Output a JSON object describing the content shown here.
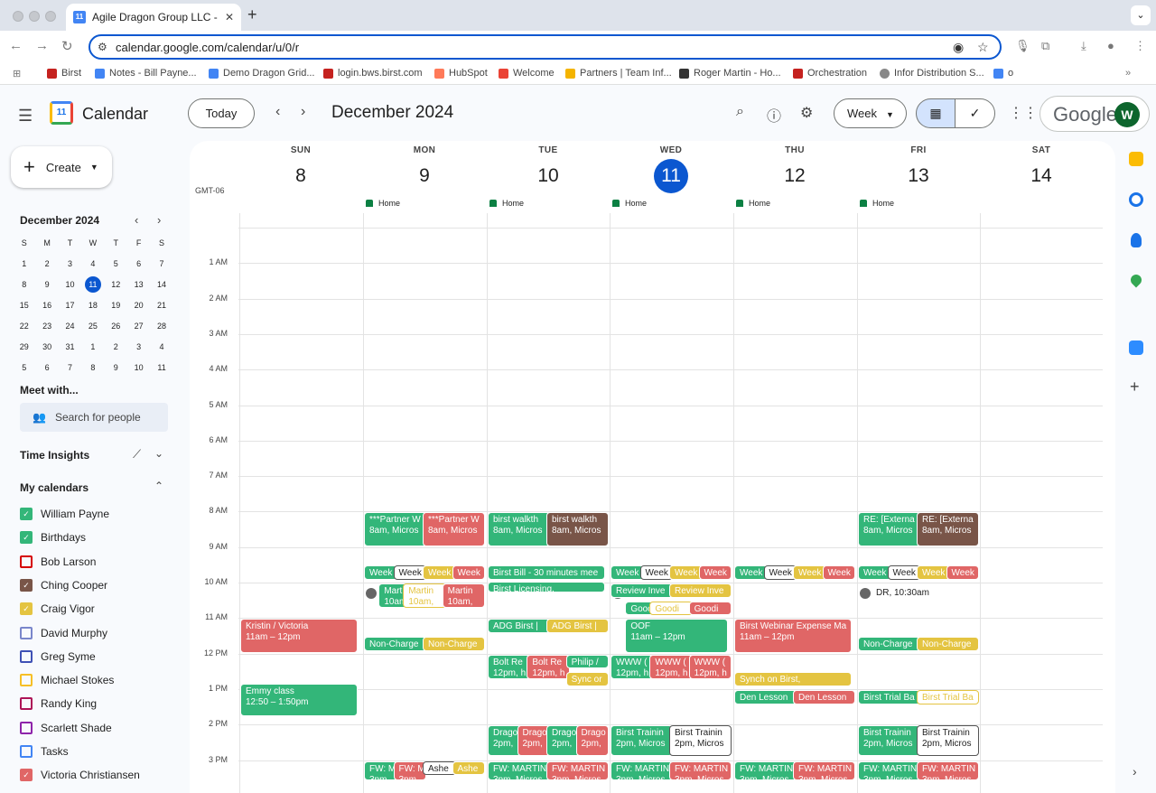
{
  "browser": {
    "tab_title": "Agile Dragon Group LLC - Calendar",
    "url": "calendar.google.com/calendar/u/0/r",
    "bookmarks": [
      {
        "label": "Birst",
        "color": "#c5221f"
      },
      {
        "label": "Notes - Bill Payne...",
        "color": "#4285f4"
      },
      {
        "label": "Demo Dragon Grid...",
        "color": "#4285f4"
      },
      {
        "label": "login.bws.birst.com",
        "color": "#c5221f"
      },
      {
        "label": "HubSpot",
        "color": "#ff7a59"
      },
      {
        "label": "Welcome",
        "color": "#ea4335"
      },
      {
        "label": "Partners | Team Inf...",
        "color": "#f4b400"
      },
      {
        "label": "Roger Martin - Ho...",
        "color": "#333333"
      },
      {
        "label": "Orchestration",
        "color": "#c5221f"
      },
      {
        "label": "Infor Distribution S...",
        "color": "#888888"
      },
      {
        "label": "o",
        "color": "#4285f4"
      }
    ]
  },
  "header": {
    "app_title": "Calendar",
    "logo_day": "11",
    "today_label": "Today",
    "month_label": "December 2024",
    "view_label": "Week",
    "brand": "Google",
    "avatar_initial": "W"
  },
  "sidebar": {
    "create_label": "Create",
    "mini_month": "December 2024",
    "weekday_initials": [
      "S",
      "M",
      "T",
      "W",
      "T",
      "F",
      "S"
    ],
    "weeks": [
      [
        "1",
        "2",
        "3",
        "4",
        "5",
        "6",
        "7"
      ],
      [
        "8",
        "9",
        "10",
        "11",
        "12",
        "13",
        "14"
      ],
      [
        "15",
        "16",
        "17",
        "18",
        "19",
        "20",
        "21"
      ],
      [
        "22",
        "23",
        "24",
        "25",
        "26",
        "27",
        "28"
      ],
      [
        "29",
        "30",
        "31",
        "1",
        "2",
        "3",
        "4"
      ],
      [
        "5",
        "6",
        "7",
        "8",
        "9",
        "10",
        "11"
      ]
    ],
    "selected_day": "11",
    "meet_with": "Meet with...",
    "search_people": "Search for people",
    "time_insights": "Time Insights",
    "my_calendars": "My calendars",
    "calendars": [
      {
        "name": "William Payne",
        "color": "#33b679",
        "checked": true
      },
      {
        "name": "Birthdays",
        "color": "#33b679",
        "checked": true
      },
      {
        "name": "Bob Larson",
        "color": "#d50000",
        "checked": false
      },
      {
        "name": "Ching Cooper",
        "color": "#795548",
        "checked": true
      },
      {
        "name": "Craig Vigor",
        "color": "#e4c441",
        "checked": true
      },
      {
        "name": "David Murphy",
        "color": "#7986cb",
        "checked": false
      },
      {
        "name": "Greg Syme",
        "color": "#3f51b5",
        "checked": false
      },
      {
        "name": "Michael Stokes",
        "color": "#f6bf26",
        "checked": false
      },
      {
        "name": "Randy King",
        "color": "#ad1457",
        "checked": false
      },
      {
        "name": "Scarlett Shade",
        "color": "#8e24aa",
        "checked": false
      },
      {
        "name": "Tasks",
        "color": "#4285f4",
        "checked": false
      },
      {
        "name": "Victoria Christiansen",
        "color": "#e06666",
        "checked": true
      }
    ]
  },
  "week": {
    "timezone": "GMT-06",
    "days": [
      {
        "name": "SUN",
        "num": "8",
        "home": ""
      },
      {
        "name": "MON",
        "num": "9",
        "home": "Home"
      },
      {
        "name": "TUE",
        "num": "10",
        "home": "Home"
      },
      {
        "name": "WED",
        "num": "11",
        "home": "Home",
        "today": true
      },
      {
        "name": "THU",
        "num": "12",
        "home": "Home"
      },
      {
        "name": "FRI",
        "num": "13",
        "home": "Home"
      },
      {
        "name": "SAT",
        "num": "14",
        "home": ""
      }
    ],
    "hours": [
      "1 AM",
      "2 AM",
      "3 AM",
      "4 AM",
      "5 AM",
      "6 AM",
      "7 AM",
      "8 AM",
      "9 AM",
      "10 AM",
      "11 AM",
      "12 PM",
      "1 PM",
      "2 PM",
      "3 PM"
    ]
  },
  "events": [
    {
      "day": 1,
      "start": 8,
      "end": 9,
      "col": 0,
      "cols": 2,
      "color": "g",
      "title": "***Partner W",
      "time": "8am, Micros"
    },
    {
      "day": 1,
      "start": 8,
      "end": 9,
      "col": 1,
      "cols": 2,
      "color": "r",
      "title": "***Partner W",
      "time": "8am, Micros"
    },
    {
      "day": 2,
      "start": 8,
      "end": 9,
      "col": 0,
      "cols": 2,
      "color": "g",
      "title": "birst walkth",
      "time": "8am, Micros"
    },
    {
      "day": 2,
      "start": 8,
      "end": 9,
      "col": 1,
      "cols": 2,
      "color": "b",
      "title": "birst walkth",
      "time": "8am, Micros"
    },
    {
      "day": 5,
      "start": 8,
      "end": 9,
      "col": 0,
      "cols": 2,
      "color": "g",
      "title": "RE: [Externa",
      "time": "8am, Micros"
    },
    {
      "day": 5,
      "start": 8,
      "end": 9,
      "col": 1,
      "cols": 2,
      "color": "b",
      "title": "RE: [Externa",
      "time": "8am, Micros"
    },
    {
      "day": 1,
      "start": 9.5,
      "end": 9.95,
      "col": 0,
      "cols": 4,
      "color": "g",
      "title": "Week",
      "time": ""
    },
    {
      "day": 1,
      "start": 9.5,
      "end": 9.95,
      "col": 1,
      "cols": 4,
      "color": "w",
      "title": "Week",
      "time": ""
    },
    {
      "day": 1,
      "start": 9.5,
      "end": 9.95,
      "col": 2,
      "cols": 4,
      "color": "y",
      "title": "Week",
      "time": ""
    },
    {
      "day": 1,
      "start": 9.5,
      "end": 9.95,
      "col": 3,
      "cols": 4,
      "color": "r",
      "title": "Week",
      "time": ""
    },
    {
      "day": 2,
      "start": 9.5,
      "end": 9.95,
      "col": 0,
      "cols": 1,
      "color": "g",
      "title": "Birst Bill - 30 minutes mee",
      "time": ""
    },
    {
      "day": 2,
      "start": 9.95,
      "end": 10.2,
      "col": 0,
      "cols": 1,
      "color": "g",
      "title": "Birst Licensing,",
      "time": "10am"
    },
    {
      "day": 3,
      "start": 9.5,
      "end": 9.95,
      "col": 0,
      "cols": 4,
      "color": "g",
      "title": "Week",
      "time": ""
    },
    {
      "day": 3,
      "start": 9.5,
      "end": 9.95,
      "col": 1,
      "cols": 4,
      "color": "w",
      "title": "Week",
      "time": ""
    },
    {
      "day": 3,
      "start": 9.5,
      "end": 9.95,
      "col": 2,
      "cols": 4,
      "color": "y",
      "title": "Week",
      "time": ""
    },
    {
      "day": 3,
      "start": 9.5,
      "end": 9.95,
      "col": 3,
      "cols": 4,
      "color": "r",
      "title": "Week",
      "time": ""
    },
    {
      "day": 4,
      "start": 9.5,
      "end": 9.95,
      "col": 0,
      "cols": 4,
      "color": "g",
      "title": "Week",
      "time": ""
    },
    {
      "day": 4,
      "start": 9.5,
      "end": 9.95,
      "col": 1,
      "cols": 4,
      "color": "w",
      "title": "Week",
      "time": ""
    },
    {
      "day": 4,
      "start": 9.5,
      "end": 9.95,
      "col": 2,
      "cols": 4,
      "color": "y",
      "title": "Week",
      "time": ""
    },
    {
      "day": 4,
      "start": 9.5,
      "end": 9.95,
      "col": 3,
      "cols": 4,
      "color": "r",
      "title": "Week",
      "time": ""
    },
    {
      "day": 5,
      "start": 9.5,
      "end": 9.95,
      "col": 0,
      "cols": 4,
      "color": "g",
      "title": "Week",
      "time": ""
    },
    {
      "day": 5,
      "start": 9.5,
      "end": 9.95,
      "col": 1,
      "cols": 4,
      "color": "w",
      "title": "Week",
      "time": ""
    },
    {
      "day": 5,
      "start": 9.5,
      "end": 9.95,
      "col": 2,
      "cols": 4,
      "color": "y",
      "title": "Week",
      "time": ""
    },
    {
      "day": 5,
      "start": 9.5,
      "end": 9.95,
      "col": 3,
      "cols": 4,
      "color": "r",
      "title": "Week",
      "time": ""
    },
    {
      "day": 1,
      "start": 10,
      "end": 10.75,
      "col": 0,
      "cols": 3,
      "color": "g",
      "title": "Martin",
      "time": "10am,",
      "offset": 0.12
    },
    {
      "day": 1,
      "start": 10,
      "end": 10.75,
      "col": 1,
      "cols": 3,
      "color": "wy",
      "title": "Martin",
      "time": "10am,"
    },
    {
      "day": 1,
      "start": 10,
      "end": 10.75,
      "col": 2,
      "cols": 3,
      "color": "r",
      "title": "Martin",
      "time": "10am,"
    },
    {
      "day": 3,
      "start": 10,
      "end": 10.45,
      "col": 0,
      "cols": 2,
      "color": "g",
      "title": "Review Inve",
      "time": ""
    },
    {
      "day": 3,
      "start": 10,
      "end": 10.45,
      "col": 1,
      "cols": 2,
      "color": "y",
      "title": "Review Inve",
      "time": ""
    },
    {
      "day": 3,
      "start": 10.5,
      "end": 10.95,
      "col": 0,
      "cols": 3,
      "color": "g",
      "title": "Goodi",
      "time": "",
      "offset": 0.12
    },
    {
      "day": 3,
      "start": 10.5,
      "end": 10.95,
      "col": 1,
      "cols": 3,
      "color": "wy",
      "title": "Goodi",
      "time": ""
    },
    {
      "day": 3,
      "start": 10.5,
      "end": 10.95,
      "col": 2,
      "cols": 3,
      "color": "r",
      "title": "Goodi",
      "time": ""
    },
    {
      "day": 0,
      "start": 11,
      "end": 12,
      "col": 0,
      "cols": 1,
      "color": "r",
      "title": "Kristin / Victoria",
      "time": "11am – 12pm"
    },
    {
      "day": 2,
      "start": 11,
      "end": 11.45,
      "col": 0,
      "cols": 2,
      "color": "g",
      "title": "ADG Birst | ",
      "time": ""
    },
    {
      "day": 2,
      "start": 11,
      "end": 11.45,
      "col": 1,
      "cols": 2,
      "color": "y",
      "title": "ADG Birst | ",
      "time": ""
    },
    {
      "day": 3,
      "start": 11,
      "end": 12,
      "col": 0,
      "cols": 1,
      "color": "g",
      "title": "OOF",
      "time": "11am – 12pm",
      "offset": 0.12
    },
    {
      "day": 4,
      "start": 11,
      "end": 12,
      "col": 0,
      "cols": 1,
      "color": "r",
      "title": "Birst Webinar Expense Ma",
      "time": "11am – 12pm"
    },
    {
      "day": 1,
      "start": 11.5,
      "end": 11.95,
      "col": 0,
      "cols": 2,
      "color": "g",
      "title": "Non-Charge",
      "time": ""
    },
    {
      "day": 1,
      "start": 11.5,
      "end": 11.95,
      "col": 1,
      "cols": 2,
      "color": "y",
      "title": "Non-Charge",
      "time": ""
    },
    {
      "day": 5,
      "start": 11.5,
      "end": 11.95,
      "col": 0,
      "cols": 2,
      "color": "g",
      "title": "Non-Charge",
      "time": ""
    },
    {
      "day": 5,
      "start": 11.5,
      "end": 11.95,
      "col": 1,
      "cols": 2,
      "color": "y",
      "title": "Non-Charge",
      "time": ""
    },
    {
      "day": 2,
      "start": 12,
      "end": 12.75,
      "col": 0,
      "cols": 3,
      "color": "g",
      "title": "Bolt Re",
      "time": "12pm, h"
    },
    {
      "day": 2,
      "start": 12,
      "end": 12.75,
      "col": 1,
      "cols": 3,
      "color": "r",
      "title": "Bolt Re",
      "time": "12pm, h"
    },
    {
      "day": 2,
      "start": 12,
      "end": 12.45,
      "col": 2,
      "cols": 3,
      "color": "g",
      "title": "Philip /",
      "time": ""
    },
    {
      "day": 2,
      "start": 12.5,
      "end": 12.95,
      "col": 2,
      "cols": 3,
      "color": "y",
      "title": "Sync or",
      "time": ""
    },
    {
      "day": 3,
      "start": 12,
      "end": 12.75,
      "col": 0,
      "cols": 3,
      "color": "g",
      "title": "WWW (",
      "time": "12pm, h"
    },
    {
      "day": 3,
      "start": 12,
      "end": 12.75,
      "col": 1,
      "cols": 3,
      "color": "r",
      "title": "WWW (",
      "time": "12pm, h"
    },
    {
      "day": 3,
      "start": 12,
      "end": 12.75,
      "col": 2,
      "cols": 3,
      "color": "r",
      "title": "WWW (",
      "time": "12pm, h"
    },
    {
      "day": 4,
      "start": 12.5,
      "end": 12.95,
      "col": 0,
      "cols": 1,
      "color": "y",
      "title": "Synch on Birst,",
      "time": "12:30pm"
    },
    {
      "day": 0,
      "start": 12.83,
      "end": 13.8,
      "col": 0,
      "cols": 1,
      "color": "g",
      "title": "Emmy class",
      "time": "12:50 – 1:50pm"
    },
    {
      "day": 4,
      "start": 13,
      "end": 13.45,
      "col": 0,
      "cols": 2,
      "color": "g",
      "title": "Den Lesson",
      "time": ""
    },
    {
      "day": 4,
      "start": 13,
      "end": 13.45,
      "col": 1,
      "cols": 2,
      "color": "r",
      "title": "Den Lesson",
      "time": ""
    },
    {
      "day": 5,
      "start": 13,
      "end": 13.45,
      "col": 0,
      "cols": 2,
      "color": "g",
      "title": "Birst Trial Ba",
      "time": ""
    },
    {
      "day": 5,
      "start": 13,
      "end": 13.45,
      "col": 1,
      "cols": 2,
      "color": "wy",
      "title": "Birst Trial Ba",
      "time": ""
    },
    {
      "day": 2,
      "start": 14,
      "end": 14.9,
      "col": 0,
      "cols": 4,
      "color": "g",
      "title": "Drago",
      "time": "2pm,"
    },
    {
      "day": 2,
      "start": 14,
      "end": 14.9,
      "col": 1,
      "cols": 4,
      "color": "r",
      "title": "Drago",
      "time": "2pm,"
    },
    {
      "day": 2,
      "start": 14,
      "end": 14.9,
      "col": 2,
      "cols": 4,
      "color": "g",
      "title": "Drago",
      "time": "2pm,"
    },
    {
      "day": 2,
      "start": 14,
      "end": 14.9,
      "col": 3,
      "cols": 4,
      "color": "r",
      "title": "Drago",
      "time": "2pm,"
    },
    {
      "day": 3,
      "start": 14,
      "end": 14.9,
      "col": 0,
      "cols": 2,
      "color": "g",
      "title": "Birst Trainin",
      "time": "2pm, Micros"
    },
    {
      "day": 3,
      "start": 14,
      "end": 14.9,
      "col": 1,
      "cols": 2,
      "color": "w",
      "title": "Birst Trainin",
      "time": "2pm, Micros"
    },
    {
      "day": 5,
      "start": 14,
      "end": 14.9,
      "col": 0,
      "cols": 2,
      "color": "g",
      "title": "Birst Trainin",
      "time": "2pm, Micros"
    },
    {
      "day": 5,
      "start": 14,
      "end": 14.9,
      "col": 1,
      "cols": 2,
      "color": "w",
      "title": "Birst Trainin",
      "time": "2pm, Micros"
    },
    {
      "day": 1,
      "start": 15,
      "end": 15.6,
      "col": 0,
      "cols": 4,
      "color": "g",
      "title": "FW: M",
      "time": "3pm"
    },
    {
      "day": 1,
      "start": 15,
      "end": 15.6,
      "col": 1,
      "cols": 4,
      "color": "r",
      "title": "FW: M",
      "time": "3pm"
    },
    {
      "day": 1,
      "start": 15,
      "end": 15.45,
      "col": 2,
      "cols": 4,
      "color": "w",
      "title": "Ashe",
      "time": ""
    },
    {
      "day": 1,
      "start": 15,
      "end": 15.45,
      "col": 3,
      "cols": 4,
      "color": "y",
      "title": "Ashe",
      "time": ""
    },
    {
      "day": 2,
      "start": 15,
      "end": 15.6,
      "col": 0,
      "cols": 2,
      "color": "g",
      "title": "FW: MARTIN",
      "time": "3pm, Micros"
    },
    {
      "day": 2,
      "start": 15,
      "end": 15.6,
      "col": 1,
      "cols": 2,
      "color": "r",
      "title": "FW: MARTIN",
      "time": "3pm, Micros"
    },
    {
      "day": 3,
      "start": 15,
      "end": 15.6,
      "col": 0,
      "cols": 2,
      "color": "g",
      "title": "FW: MARTIN",
      "time": "3pm, Micros"
    },
    {
      "day": 3,
      "start": 15,
      "end": 15.6,
      "col": 1,
      "cols": 2,
      "color": "r",
      "title": "FW: MARTIN",
      "time": "3pm, Micros"
    },
    {
      "day": 4,
      "start": 15,
      "end": 15.6,
      "col": 0,
      "cols": 2,
      "color": "g",
      "title": "FW: MARTIN",
      "time": "3pm, Micros"
    },
    {
      "day": 4,
      "start": 15,
      "end": 15.6,
      "col": 1,
      "cols": 2,
      "color": "r",
      "title": "FW: MARTIN",
      "time": "3pm, Micros"
    },
    {
      "day": 5,
      "start": 15,
      "end": 15.6,
      "col": 0,
      "cols": 2,
      "color": "g",
      "title": "FW: MARTIN",
      "time": "3pm, Micros"
    },
    {
      "day": 5,
      "start": 15,
      "end": 15.6,
      "col": 1,
      "cols": 2,
      "color": "r",
      "title": "FW: MARTIN",
      "time": "3pm, Micros"
    }
  ],
  "task_markers": [
    {
      "day": 1,
      "hour": 10.7,
      "label": ""
    },
    {
      "day": 3,
      "hour": 10.7,
      "label": ""
    },
    {
      "day": 5,
      "hour": 10.7,
      "label": "DR, 10:30am"
    }
  ]
}
